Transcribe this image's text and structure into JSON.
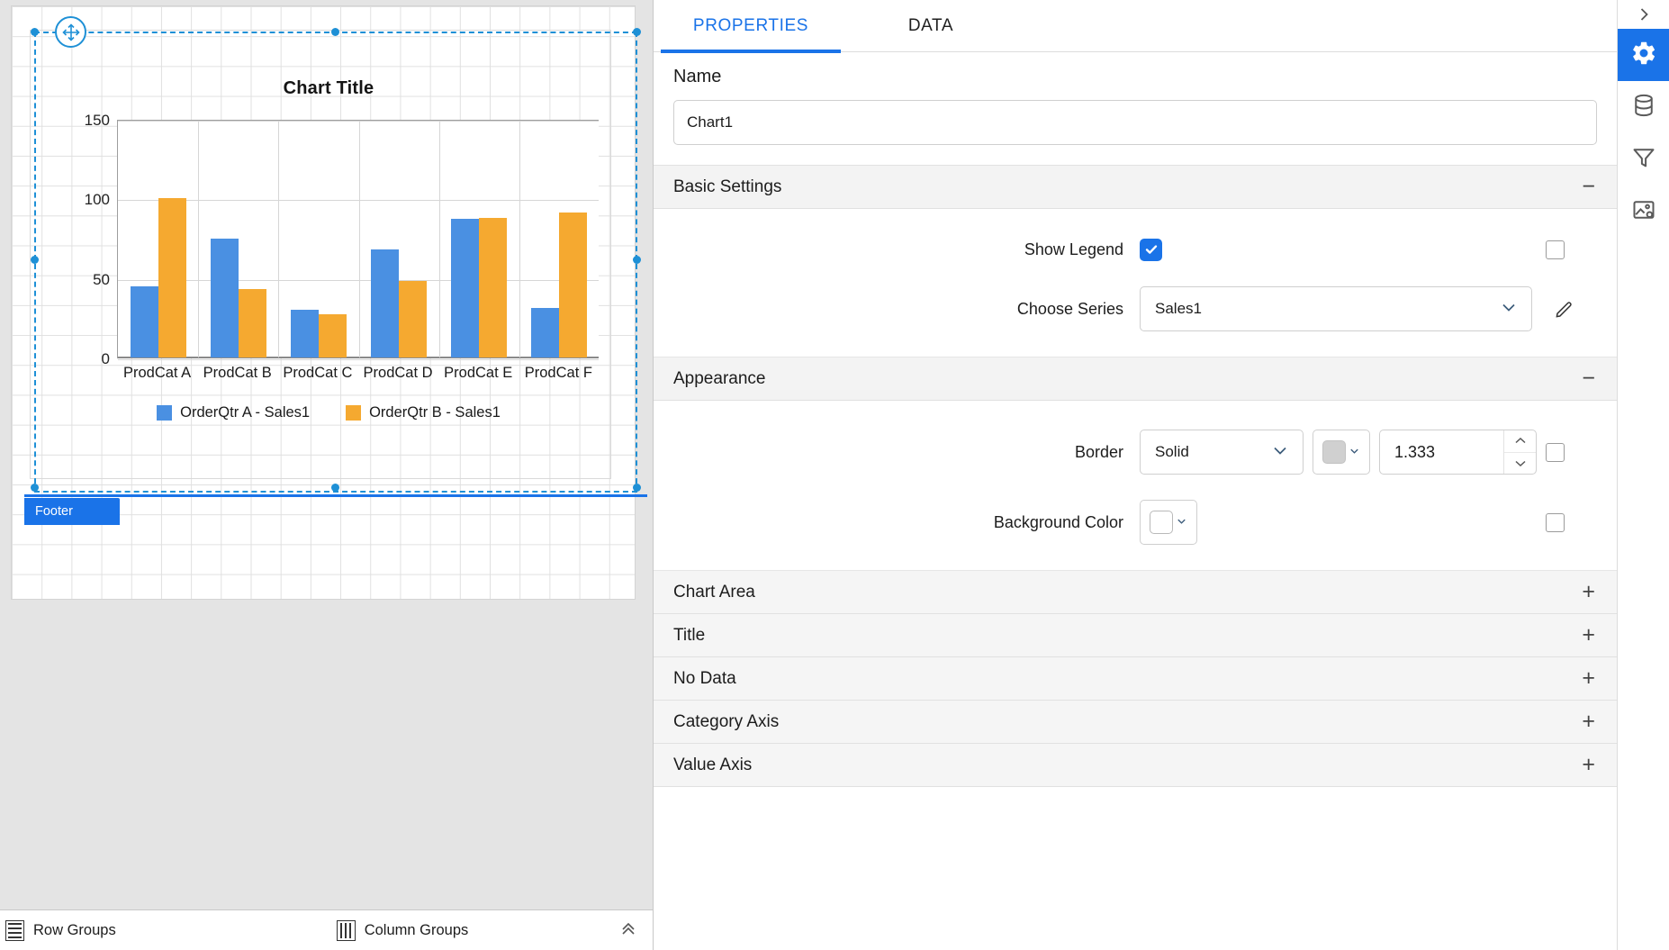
{
  "designer": {
    "footer_band_label": "Footer",
    "move_handle_icon": "move-cross-icon"
  },
  "chart_data": {
    "type": "bar",
    "title": "Chart Title",
    "xlabel": "",
    "ylabel": "",
    "ylim": [
      0,
      150
    ],
    "yticks": [
      0,
      50,
      100,
      150
    ],
    "grid": true,
    "legend_position": "bottom",
    "categories": [
      "ProdCat A",
      "ProdCat B",
      "ProdCat C",
      "ProdCat D",
      "ProdCat E",
      "ProdCat F"
    ],
    "series": [
      {
        "name": "OrderQtr A - Sales1",
        "color": "#4a90e2",
        "values": [
          45,
          75,
          30,
          68,
          87,
          31
        ]
      },
      {
        "name": "OrderQtr B - Sales1",
        "color": "#f5a930",
        "values": [
          100,
          43,
          27,
          48,
          88,
          91
        ]
      }
    ]
  },
  "groups_bar": {
    "row_groups_label": "Row Groups",
    "column_groups_label": "Column Groups",
    "row_groups_icon": "row-groups-icon",
    "column_groups_icon": "column-groups-icon",
    "collapse_icon": "double-chevron-up-icon"
  },
  "properties": {
    "tabs": [
      {
        "id": "properties",
        "label": "PROPERTIES",
        "active": true
      },
      {
        "id": "data",
        "label": "DATA",
        "active": false
      }
    ],
    "name": {
      "label": "Name",
      "value": "Chart1",
      "placeholder": "Name"
    },
    "basic_settings": {
      "title": "Basic Settings",
      "toggle_sign": "−",
      "show_legend": {
        "label": "Show Legend",
        "checked": true,
        "expression_checkbox": false
      },
      "choose_series": {
        "label": "Choose Series",
        "value": "Sales1",
        "chevron_icon": "chevron-down-icon",
        "edit_icon": "pencil-icon"
      }
    },
    "appearance": {
      "title": "Appearance",
      "toggle_sign": "−",
      "border": {
        "label": "Border",
        "style_value": "Solid",
        "color_value": "#d0d0d0",
        "width_value": "1.333",
        "expression_checkbox": false,
        "spin_up_icon": "chevron-up-icon",
        "spin_down_icon": "chevron-down-icon"
      },
      "background_color": {
        "label": "Background Color",
        "color_value": "#ffffff",
        "expression_checkbox": false
      }
    },
    "collapsed_sections": [
      {
        "title": "Chart Area",
        "sign": "+"
      },
      {
        "title": "Title",
        "sign": "+"
      },
      {
        "title": "No Data",
        "sign": "+"
      },
      {
        "title": "Category Axis",
        "sign": "+"
      },
      {
        "title": "Value Axis",
        "sign": "+"
      }
    ]
  },
  "rail": {
    "expand_icon": "chevron-right-icon",
    "buttons": [
      {
        "id": "settings",
        "icon": "gear-icon",
        "active": true
      },
      {
        "id": "data-source",
        "icon": "database-icon",
        "active": false
      },
      {
        "id": "filter",
        "icon": "funnel-icon",
        "active": false
      },
      {
        "id": "image",
        "icon": "image-settings-icon",
        "active": false
      }
    ]
  },
  "colors": {
    "accent": "#1a73e8",
    "series_a": "#4a90e2",
    "series_b": "#f5a930",
    "selection": "#1e90d6"
  }
}
